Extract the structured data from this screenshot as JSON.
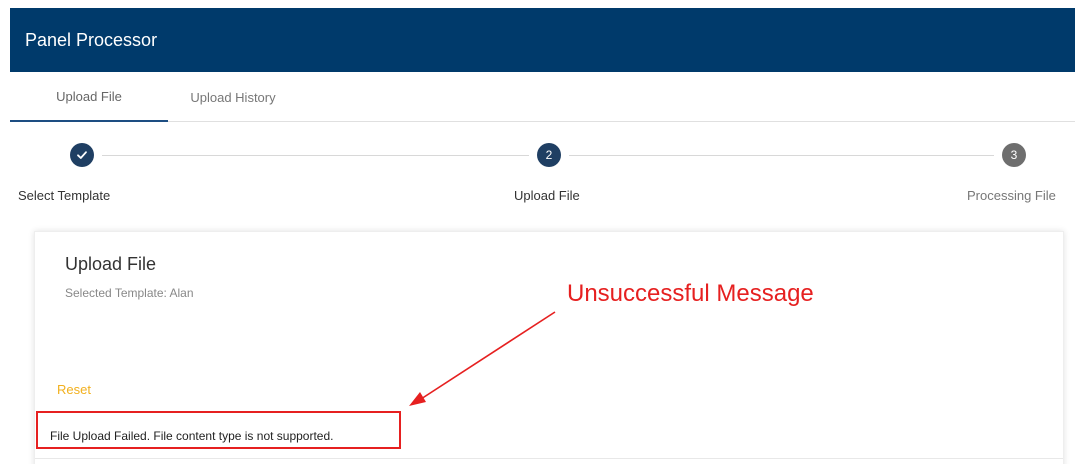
{
  "header": {
    "title": "Panel Processor"
  },
  "tabs": [
    {
      "label": "Upload File",
      "active": true
    },
    {
      "label": "Upload History",
      "active": false
    }
  ],
  "stepper": {
    "steps": [
      {
        "label": "Select Template",
        "status": "completed",
        "marker": ""
      },
      {
        "label": "Upload File",
        "status": "current",
        "marker": "2"
      },
      {
        "label": "Processing File",
        "status": "pending",
        "marker": "3"
      }
    ]
  },
  "card": {
    "title": "Upload File",
    "subtitle": "Selected Template: Alan",
    "reset_label": "Reset",
    "error_message": "File Upload Failed. File content type is not supported."
  },
  "annotation": {
    "label": "Unsuccessful Message",
    "color": "#e62020"
  },
  "colors": {
    "header_bg": "#003a6b",
    "step_active": "#1f3f63",
    "step_pending": "#6e6e6e",
    "reset_link": "#f2b01e"
  }
}
